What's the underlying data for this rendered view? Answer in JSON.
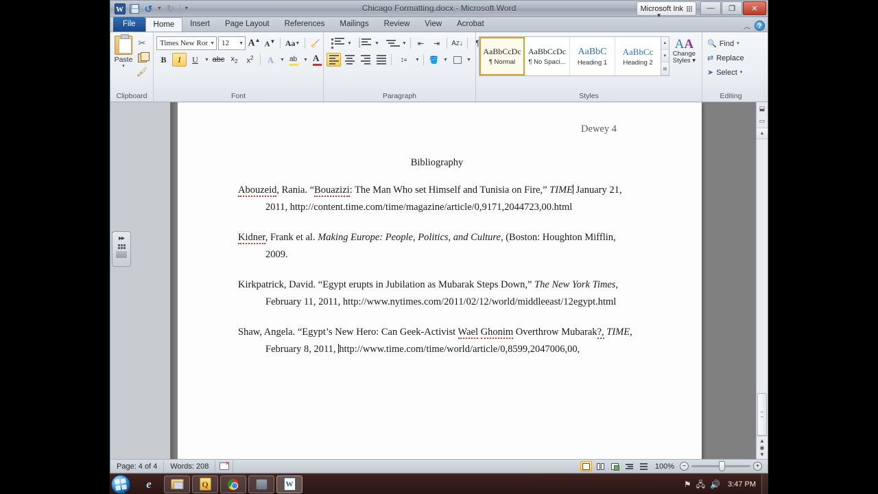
{
  "window": {
    "title": "Chicago Formatting.docx - Microsoft Word",
    "ink_toolbar_label": "Microsoft Ink",
    "minimize_label": "—",
    "restore_label": "❐",
    "close_label": "✕",
    "collapse_ribbon_label": "︿",
    "help_label": "?"
  },
  "qat": {
    "app_icon": "word-logo",
    "save_label": "save-icon",
    "undo_label": "↰",
    "redo_label": "↱",
    "customize_label": "▾"
  },
  "tabs": [
    {
      "label": "File",
      "active": false,
      "file": true
    },
    {
      "label": "Home",
      "active": true
    },
    {
      "label": "Insert",
      "active": false
    },
    {
      "label": "Page Layout",
      "active": false
    },
    {
      "label": "References",
      "active": false
    },
    {
      "label": "Mailings",
      "active": false
    },
    {
      "label": "Review",
      "active": false
    },
    {
      "label": "View",
      "active": false
    },
    {
      "label": "Acrobat",
      "active": false
    }
  ],
  "ribbon": {
    "clipboard": {
      "group_label": "Clipboard",
      "paste_label": "Paste",
      "paste_caret": "▾",
      "cut_label": "✂",
      "copy_label": "copy-icon",
      "format_painter_label": "🖌"
    },
    "font": {
      "group_label": "Font",
      "font_name": "Times New Rom",
      "font_size": "12",
      "grow_font": "A",
      "shrink_font": "A",
      "change_case": "Aa",
      "clear_formatting": "clear-formatting-icon",
      "bold": "B",
      "italic": "I",
      "underline": "U",
      "strikethrough": "abc",
      "subscript": "x",
      "superscript": "x",
      "text_effects": "A",
      "highlight": "ab",
      "font_color": "A",
      "highlight_color": "#ffdd33",
      "font_color_value": "#c0392b",
      "italic_active": true
    },
    "paragraph": {
      "group_label": "Paragraph",
      "bullets": "bullets-icon",
      "numbering": "numbering-icon",
      "multilevel": "multilevel-list-icon",
      "decrease_indent": "decrease-indent-icon",
      "increase_indent": "increase-indent-icon",
      "sort": "sort-icon",
      "show_marks": "¶",
      "align_left": "align-left-icon",
      "align_center": "align-center-icon",
      "align_right": "align-right-icon",
      "justify": "justify-icon",
      "line_spacing": "line-spacing-icon",
      "shading": "shading-icon",
      "borders": "borders-icon",
      "align_left_active": true
    },
    "styles": {
      "group_label": "Styles",
      "items": [
        {
          "preview": "AaBbCcDc",
          "name": "¶ Normal",
          "active": true,
          "kind": "normal"
        },
        {
          "preview": "AaBbCcDc",
          "name": "¶ No Spaci...",
          "active": false,
          "kind": "normal"
        },
        {
          "preview": "AaBbC",
          "name": "Heading 1",
          "active": false,
          "kind": "h1"
        },
        {
          "preview": "AaBbCc",
          "name": "Heading 2",
          "active": false,
          "kind": "h2"
        }
      ],
      "change_styles_line1": "Change",
      "change_styles_line2": "Styles ▾",
      "scroll_up": "▲",
      "scroll_down": "▼",
      "more": "▤"
    },
    "editing": {
      "group_label": "Editing",
      "find_label": "Find",
      "find_caret": "▾",
      "replace_label": "Replace",
      "select_label": "Select",
      "select_caret": "▾"
    }
  },
  "navigation_pane": {
    "expand_handle": "▸▸"
  },
  "document": {
    "header_right": "Dewey 4",
    "title": "Bibliography",
    "entries": [
      {
        "id": "entry-abouzeid",
        "parts": [
          {
            "text": "Abouzeid",
            "style": "spell-error"
          },
          {
            "text": ", Rania.  “",
            "style": "plain"
          },
          {
            "text": "Bouazizi",
            "style": "spell-error"
          },
          {
            "text": ":  The Man Who set Himself and Tunisia  on Fire,” ",
            "style": "plain"
          },
          {
            "text": "TIME",
            "style": "italic"
          },
          {
            "text": "",
            "style": "caret"
          },
          {
            "text": " January 21, 2011, http://content.time.com/time/magazine/article/0,9171,2044723,00.html",
            "style": "plain"
          }
        ]
      },
      {
        "id": "entry-kidner",
        "parts": [
          {
            "text": "Kidner",
            "style": "spell-error"
          },
          {
            "text": ", Frank et al. ",
            "style": "plain"
          },
          {
            "text": "Making Europe: People, Politics,  and Culture",
            "style": "italic"
          },
          {
            "text": ", (Boston: Houghton Mifflin, 2009.",
            "style": "plain"
          }
        ]
      },
      {
        "id": "entry-kirkpatrick",
        "parts": [
          {
            "text": "Kirkpatrick,  David. “Egypt erupts in Jubilation as Mubarak Steps Down,” ",
            "style": "plain"
          },
          {
            "text": "The New York Times",
            "style": "italic"
          },
          {
            "text": ", February 11, 2011, http://www.nytimes.com/2011/02/12/world/middleeast/12egypt.html",
            "style": "plain"
          }
        ]
      },
      {
        "id": "entry-shaw",
        "parts": [
          {
            "text": "Shaw, Angela. “Egypt’s New Hero:  Can Geek-Activist ",
            "style": "plain"
          },
          {
            "text": "Wael",
            "style": "spell-error"
          },
          {
            "text": " ",
            "style": "plain"
          },
          {
            "text": "Ghonim",
            "style": "spell-error"
          },
          {
            "text": " Overthrow Mubarak",
            "style": "plain"
          },
          {
            "text": "?,",
            "style": "gram-error"
          },
          {
            "text": " ",
            "style": "plain"
          },
          {
            "text": "TIME",
            "style": "italic"
          },
          {
            "text": ", February 8, 2011, ",
            "style": "plain"
          },
          {
            "text": "",
            "style": "caret"
          },
          {
            "text": "http://www.time.com/time/world/article/0,8599,2047006,00,",
            "style": "plain"
          }
        ]
      }
    ]
  },
  "scrollbar": {
    "split_label": "split-icon",
    "ruler_label": "ruler-icon",
    "up_arrow": "▲",
    "down_arrow": "▼",
    "browse_prev": "▲",
    "browse_object": "◉",
    "browse_next": "▼"
  },
  "statusbar": {
    "page_label": "Page: 4 of 4",
    "words_label": "Words: 208",
    "spellcheck_label": "proofing-errors-icon",
    "views": [
      {
        "name": "print-layout",
        "active": true
      },
      {
        "name": "full-screen-reading",
        "active": false
      },
      {
        "name": "web-layout",
        "active": false
      },
      {
        "name": "outline",
        "active": false
      },
      {
        "name": "draft",
        "active": false
      }
    ],
    "zoom_level": "100%",
    "zoom_out": "−",
    "zoom_in": "+"
  },
  "taskbar": {
    "start_label": "start-orb",
    "items": [
      {
        "name": "internet-explorer",
        "glyph": "e",
        "state": "pinned-flat"
      },
      {
        "name": "windows-explorer",
        "glyph": "",
        "state": "pinned"
      },
      {
        "name": "quickbooks",
        "glyph": "Q",
        "state": "pinned"
      },
      {
        "name": "google-chrome",
        "glyph": "",
        "state": "pinned"
      },
      {
        "name": "misc-app",
        "glyph": "",
        "state": "pinned"
      },
      {
        "name": "microsoft-word",
        "glyph": "W",
        "state": "running"
      }
    ],
    "tray": [
      {
        "name": "action-center-flag",
        "glyph": "⚑"
      },
      {
        "name": "network-icon",
        "glyph": "🖧"
      },
      {
        "name": "volume-icon",
        "glyph": "🔊"
      }
    ],
    "clock": "3:47 PM"
  }
}
